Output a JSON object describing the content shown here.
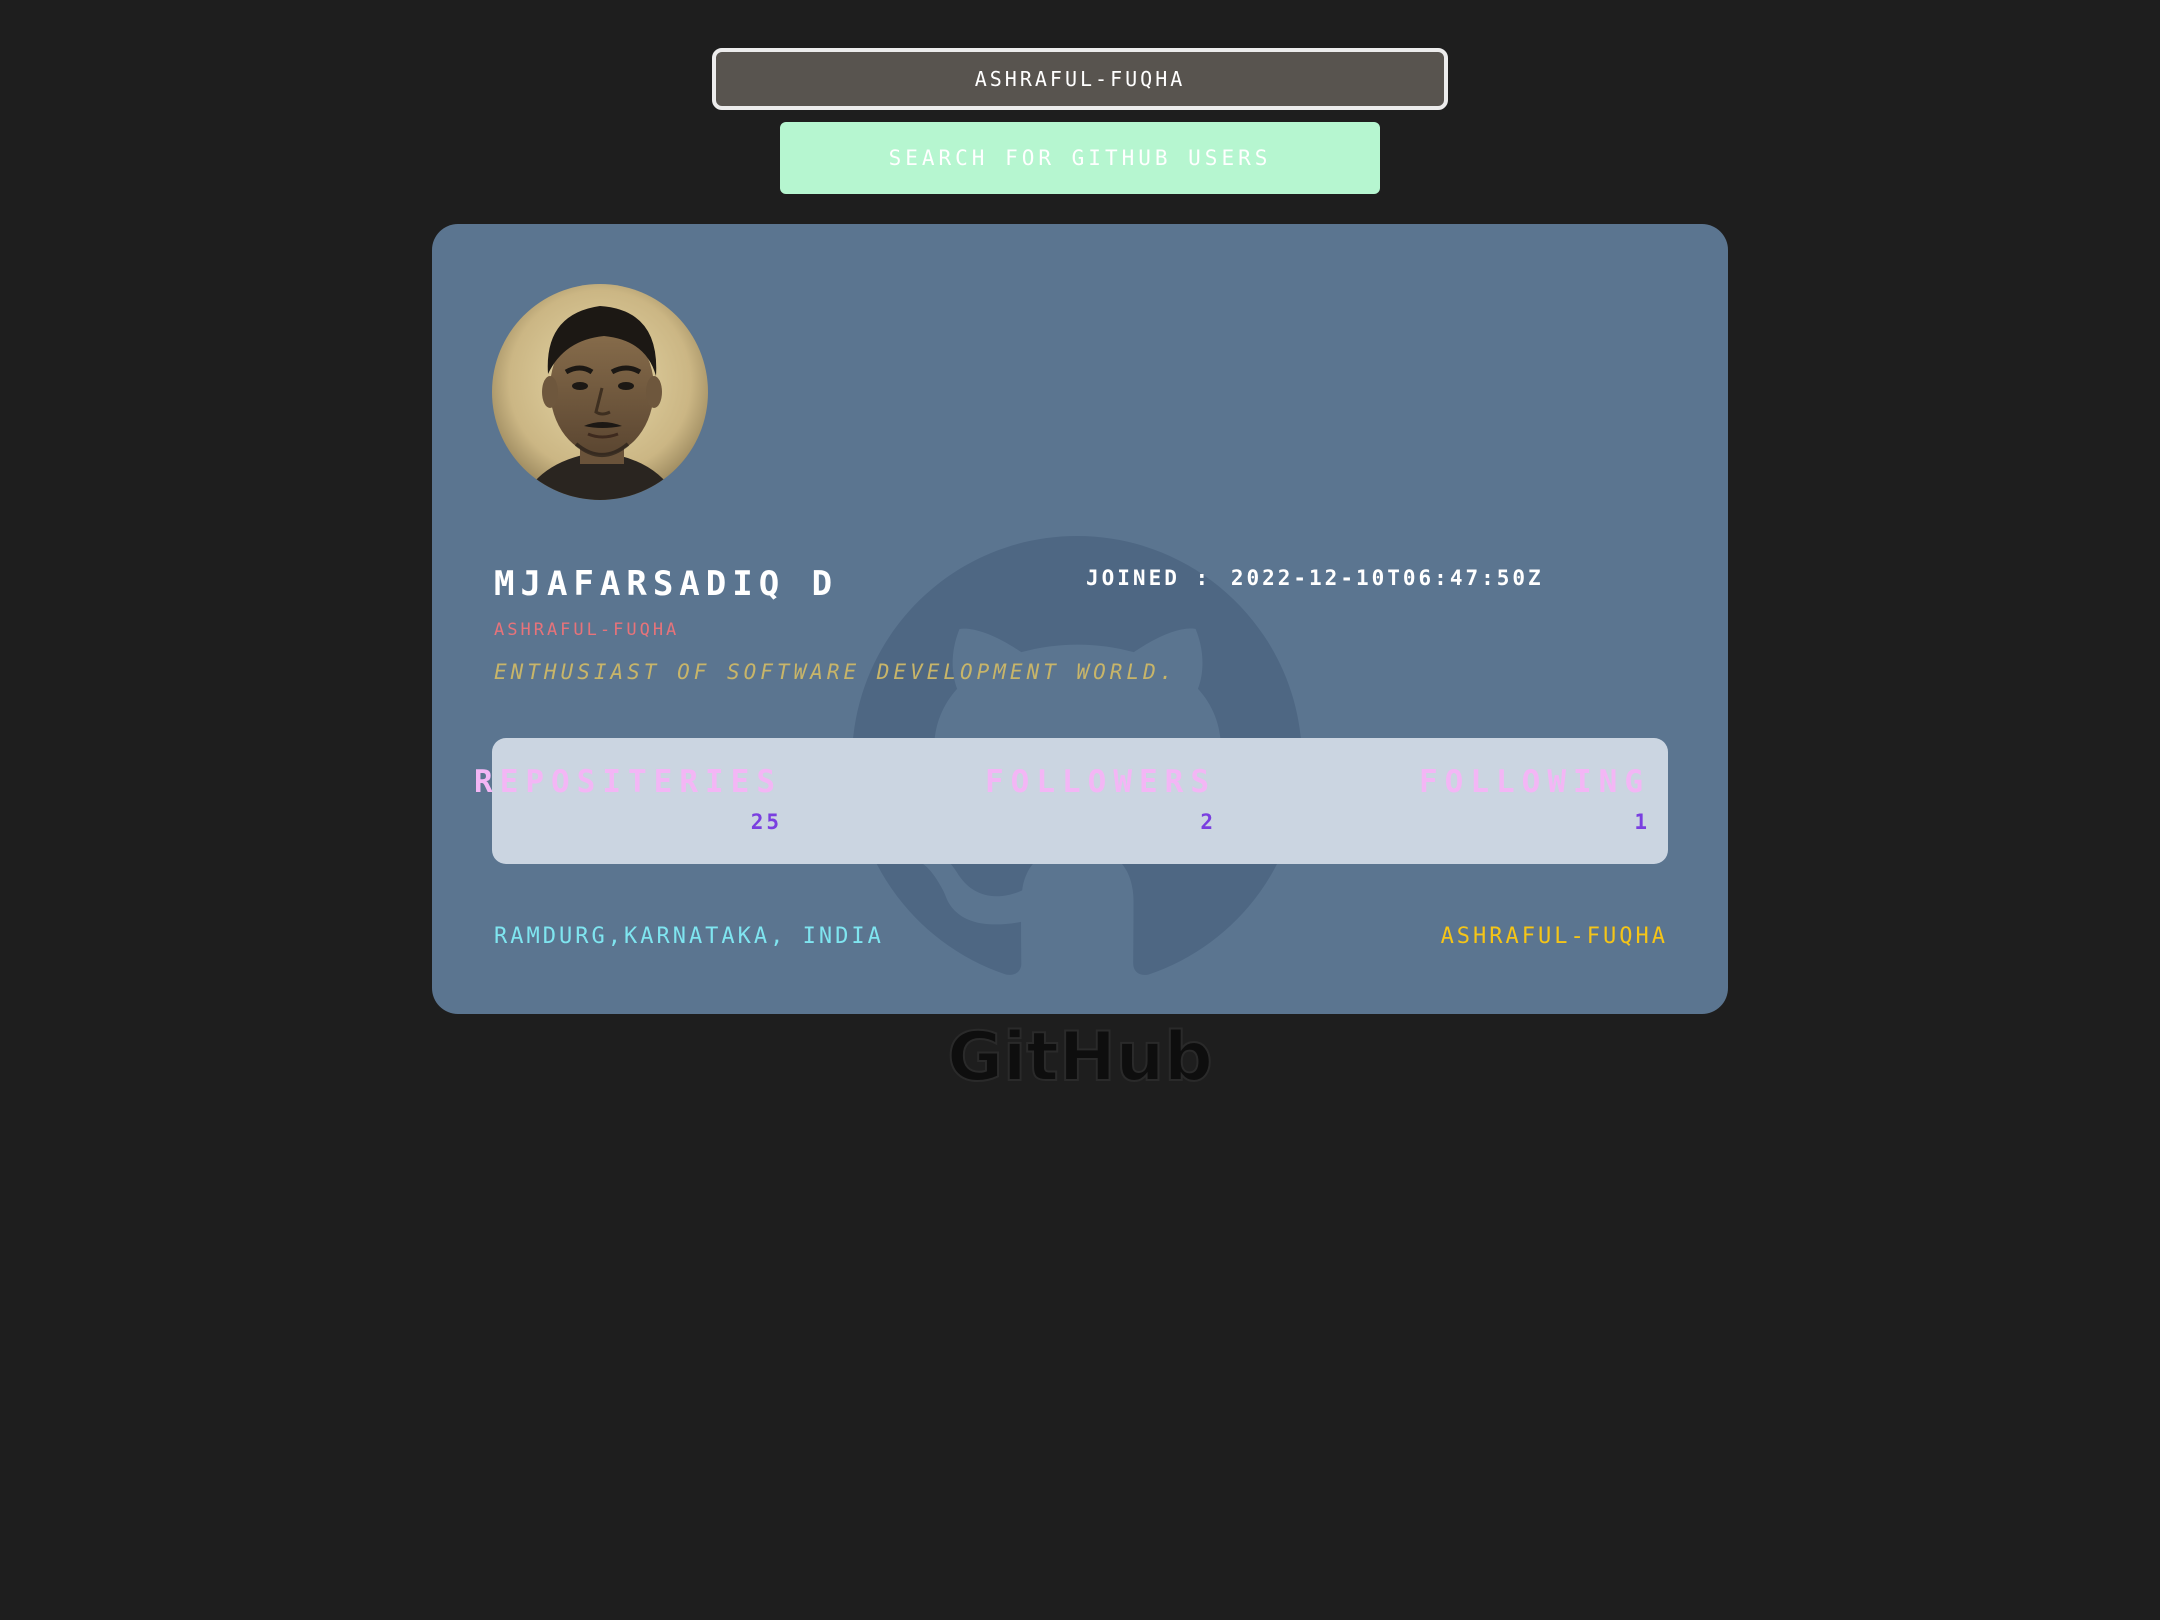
{
  "search": {
    "value": "ashraful-fuqha",
    "button_label": "Search for GitHub Users"
  },
  "profile": {
    "name": "MJAFARSADIQ D",
    "login": "ashraful-fuqha",
    "joined_label": "JOINED :",
    "joined_date": "2022-12-10T06:47:50Z",
    "bio": "Enthusiast of software development world.",
    "location": "Ramdurg,Karnataka, India",
    "profile_link": "ashraful-fuqha",
    "avatar": "user-avatar-photo"
  },
  "stats": [
    {
      "label": "Repositeries",
      "value": "25"
    },
    {
      "label": "Followers",
      "value": "2"
    },
    {
      "label": "Following",
      "value": "1"
    }
  ],
  "footer": {
    "logo_text": "GitHub"
  },
  "colors": {
    "background": "#1e1e1e",
    "card": "#5b7590",
    "search_button": "#b6f6d0",
    "stats_panel": "#cbd5e1",
    "stat_label": "#f3b6f5",
    "stat_value": "#7a3fe0",
    "login": "#e8737a",
    "bio": "#c8b569",
    "location": "#7fe5f0",
    "profile_link": "#f5c518"
  }
}
